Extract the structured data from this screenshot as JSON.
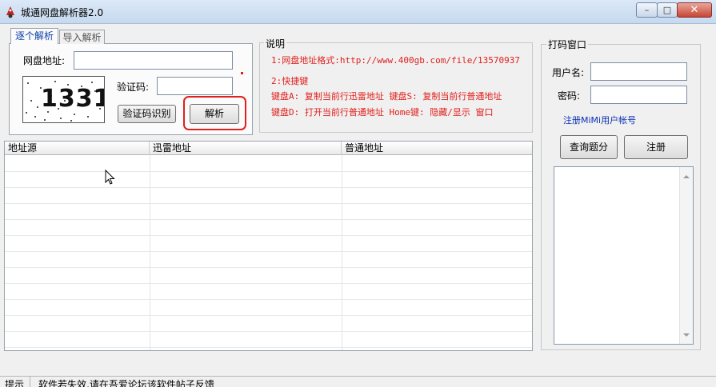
{
  "window": {
    "title": "城通网盘解析器2.0",
    "controls": {
      "minimize": "–",
      "maximize": "□",
      "close": "✕"
    }
  },
  "tabs": [
    {
      "label": "逐个解析",
      "active": true
    },
    {
      "label": "导入解析",
      "active": false
    }
  ],
  "form": {
    "url_label": "网盘地址:",
    "url_value": "",
    "captcha_image_text": "1331",
    "captcha_label": "验证码:",
    "captcha_value": "",
    "recognize_button": "验证码识别",
    "parse_button": "解析"
  },
  "info": {
    "title": "说明",
    "line1": "1:网盘地址格式:http://www.400gb.com/file/13570937",
    "line2": "2:快捷键",
    "line3": "键盘A: 复制当前行迅雷地址 键盘S: 复制当前行普通地址",
    "line4": "键盘D: 打开当前行普通地址 Home键: 隐藏/显示 窗口"
  },
  "table": {
    "columns": [
      "地址源",
      "迅雷地址",
      "普通地址"
    ],
    "rows": []
  },
  "login": {
    "title": "打码窗口",
    "username_label": "用户名:",
    "username_value": "",
    "password_label": "密码:",
    "password_value": "",
    "register_link": "注册MiMi用户帐号",
    "query_button": "查询题分",
    "register_button": "注册",
    "log_text": ""
  },
  "status": {
    "label": "提示",
    "message": "软件若失效,请在吾爱论坛该软件帖子反馈"
  },
  "colors": {
    "info_text": "#e0201c",
    "link": "#0b2fb5",
    "highlight": "#e0201c"
  }
}
